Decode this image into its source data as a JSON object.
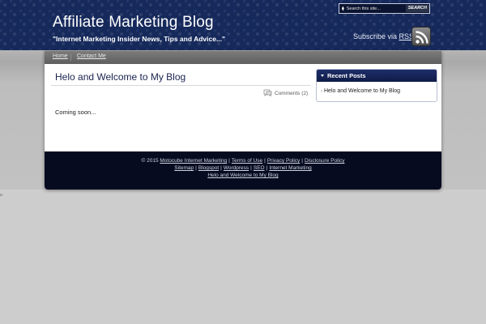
{
  "header": {
    "title": "Affiliate Marketing Blog",
    "tagline": "\"Internet Marketing Insider News, Tips and Advice...\"",
    "search": {
      "placeholder": "Search this site...",
      "button_label": "SEARCH"
    },
    "subscribe": {
      "prefix": "Subscribe via",
      "link_label": "RSS"
    },
    "rss_icon": "rss-feed-icon"
  },
  "nav": {
    "items": [
      {
        "label": "Home"
      },
      {
        "label": "Contact Me"
      }
    ]
  },
  "post": {
    "title": "Helo and Welcome to My Blog",
    "comments_label": "Comments (2)",
    "body": "Coming soon..."
  },
  "sidebar": {
    "widget_title": "Recent Posts",
    "items": [
      {
        "label": "Helo and Welcome to My Blog"
      }
    ]
  },
  "footer": {
    "copyright": "© 2015",
    "line1_links": [
      "Motocube Internet Marketing",
      "Terms of Use",
      "Privacy Policy",
      "Disclosure Policy"
    ],
    "line2_links": [
      "Sitemap",
      "Blogspot",
      "Wordpress",
      "SEO",
      "Internet Marketing"
    ],
    "line3_link": "Helo and Welcome to My Blog",
    "separator": "|"
  },
  "stray_mark": "u",
  "colors": {
    "header_bg": "#16295b",
    "page_bg": "#cdcdcd",
    "footer_bg": "#070b20",
    "widget_head": "#1d2e69",
    "post_title": "#1a2350"
  }
}
